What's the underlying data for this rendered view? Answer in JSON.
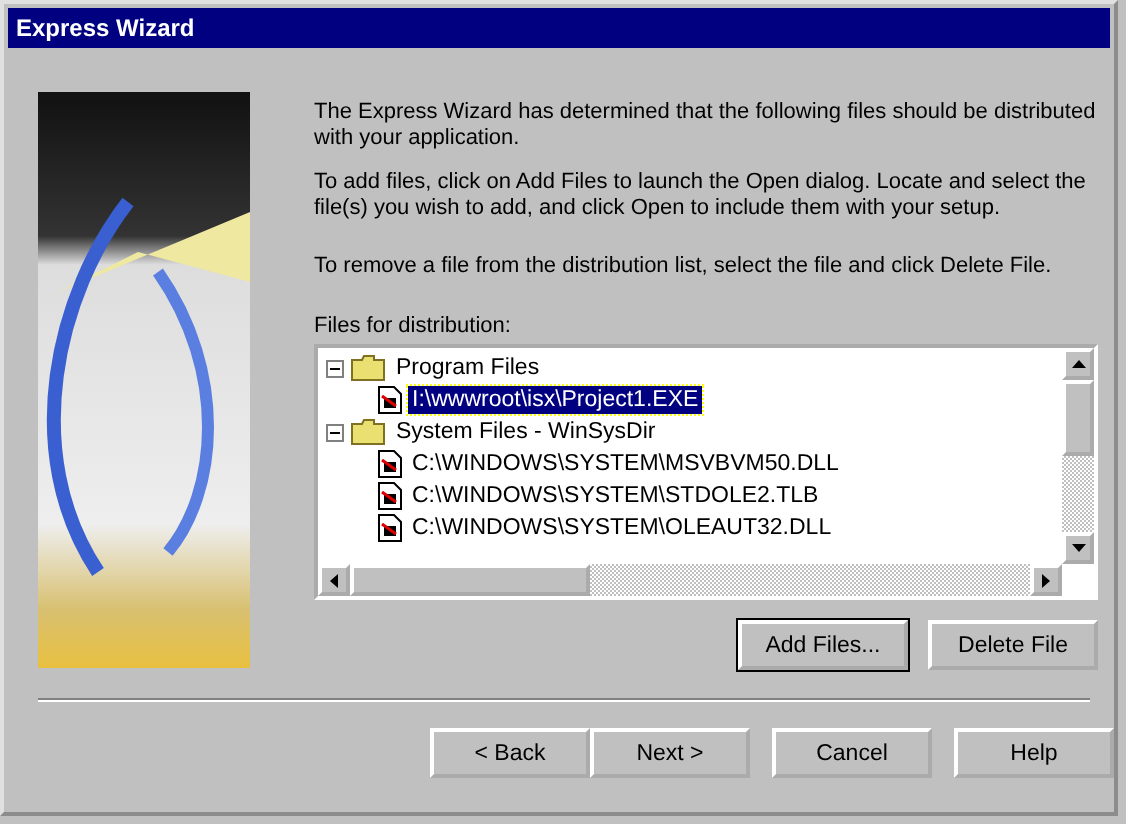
{
  "window": {
    "title": "Express Wizard"
  },
  "intro": [
    "The Express Wizard has determined that the following files should be distributed with your application.",
    "To add files, click on Add Files to launch the Open dialog.  Locate and select the file(s) you wish to add, and click Open to include them with your setup.",
    "To remove a file from the distribution list, select the file and click Delete File."
  ],
  "files_label": "Files for distribution:",
  "tree": [
    {
      "label": "Program Files",
      "expanded": true,
      "children": [
        {
          "label": "I:\\wwwroot\\isx\\Project1.EXE",
          "selected": true
        }
      ]
    },
    {
      "label": "System Files - WinSysDir",
      "expanded": true,
      "children": [
        {
          "label": "C:\\WINDOWS\\SYSTEM\\MSVBVM50.DLL",
          "selected": false
        },
        {
          "label": "C:\\WINDOWS\\SYSTEM\\STDOLE2.TLB",
          "selected": false
        },
        {
          "label": "C:\\WINDOWS\\SYSTEM\\OLEAUT32.DLL",
          "selected": false
        }
      ]
    }
  ],
  "file_buttons": [
    {
      "label": "Add Files...",
      "default": true
    },
    {
      "label": "Delete File",
      "default": false
    }
  ],
  "nav_buttons": [
    {
      "label": "< Back"
    },
    {
      "label": "Next >"
    },
    {
      "label": "Cancel"
    },
    {
      "label": "Help"
    }
  ]
}
